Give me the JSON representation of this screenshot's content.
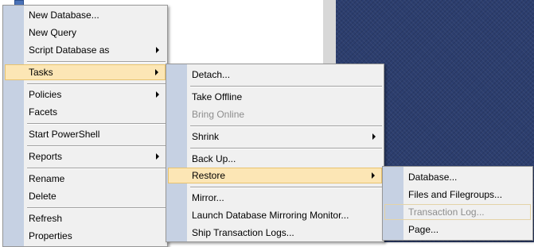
{
  "main_menu": {
    "items": [
      {
        "label": "New Database...",
        "submenu": false
      },
      {
        "label": "New Query",
        "submenu": false
      },
      {
        "label": "Script Database as",
        "submenu": true
      },
      {
        "label": "Tasks",
        "submenu": true,
        "highlighted": true
      },
      {
        "label": "Policies",
        "submenu": true
      },
      {
        "label": "Facets",
        "submenu": false
      },
      {
        "label": "Start PowerShell",
        "submenu": false
      },
      {
        "label": "Reports",
        "submenu": true
      },
      {
        "label": "Rename",
        "submenu": false
      },
      {
        "label": "Delete",
        "submenu": false
      },
      {
        "label": "Refresh",
        "submenu": false
      },
      {
        "label": "Properties",
        "submenu": false
      }
    ]
  },
  "tasks_menu": {
    "items": [
      {
        "label": "Detach...",
        "submenu": false
      },
      {
        "label": "Take Offline",
        "submenu": false
      },
      {
        "label": "Bring Online",
        "submenu": false,
        "disabled": true
      },
      {
        "label": "Shrink",
        "submenu": true
      },
      {
        "label": "Back Up...",
        "submenu": false
      },
      {
        "label": "Restore",
        "submenu": true,
        "highlighted": true
      },
      {
        "label": "Mirror...",
        "submenu": false
      },
      {
        "label": "Launch Database Mirroring Monitor...",
        "submenu": false
      },
      {
        "label": "Ship Transaction Logs...",
        "submenu": false
      }
    ]
  },
  "restore_menu": {
    "items": [
      {
        "label": "Database...",
        "submenu": false
      },
      {
        "label": "Files and Filegroups...",
        "submenu": false
      },
      {
        "label": "Transaction Log...",
        "submenu": false,
        "disabled": true,
        "focused": true
      },
      {
        "label": "Page...",
        "submenu": false
      }
    ]
  },
  "colors": {
    "menu_bg": "#f0f0f0",
    "gutter": "#c6d1e3",
    "highlight": "#fce6b5",
    "highlight_border": "#e8c36e",
    "desktop_right": "#2c3e6e"
  }
}
